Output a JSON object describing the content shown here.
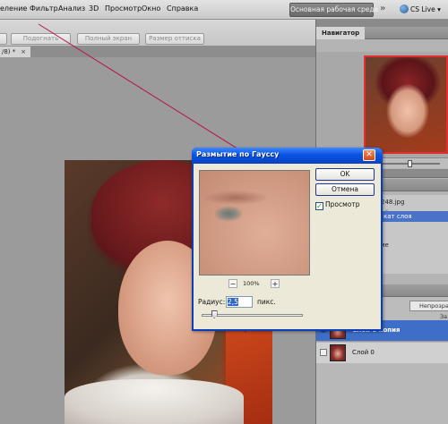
{
  "menubar": {
    "items": [
      "еление",
      "Фильтр",
      "Анализ",
      "3D",
      "Просмотр",
      "Окно",
      "Справка"
    ],
    "workspace_label": "Основная рабочая среда",
    "chevron": "»",
    "cslive_label": "CS Live ▾"
  },
  "options_bar": {
    "buttons": [
      "Подогнать",
      "Полный экран",
      "Размер оттиска"
    ]
  },
  "document": {
    "tab_label": "/8) *",
    "tab_close": "×"
  },
  "navigator": {
    "tab_label": "Навигатор",
    "zoom_level": 0.66
  },
  "info_panel": {
    "filename": "248.jpg",
    "row2": "ой",
    "highlight": "кат слоя",
    "row4": "ие"
  },
  "layers": {
    "blend_mode": "Непрозрач",
    "lock_label": "За",
    "items": [
      {
        "name": "Слой 0 копия",
        "visible": true,
        "selected": true
      },
      {
        "name": "Слой 0",
        "visible": false,
        "selected": false
      }
    ]
  },
  "dialog": {
    "title": "Размытие по Гауссу",
    "close_glyph": "✕",
    "ok_label": "OK",
    "cancel_label": "Отмена",
    "preview_label": "Просмотр",
    "preview_checked": true,
    "zoom_out": "−",
    "zoom_in": "+",
    "zoom_level": "100%",
    "radius_label": "Радиус:",
    "radius_value": "2,5",
    "radius_unit": "пикс.",
    "slider_position": 0.12
  },
  "colors": {
    "titlebar_blue": "#0a54e3",
    "selection_blue": "#3f6ec9",
    "guide_line": "#b5154c",
    "navigator_frame": "#e03030"
  }
}
